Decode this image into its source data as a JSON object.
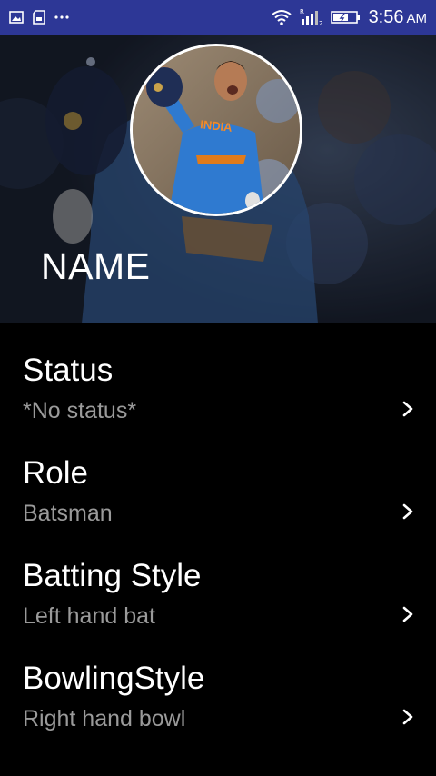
{
  "status_bar": {
    "time": "3:56",
    "ampm": "AM",
    "background": "#2d3796",
    "left_icons": [
      "image-icon",
      "sd-card-icon",
      "more-dots-icon"
    ],
    "right_icons": [
      "wifi-icon",
      "signal-icon",
      "battery-icon"
    ]
  },
  "profile": {
    "name": "NAME"
  },
  "list": [
    {
      "title": "Status",
      "value": "*No status*"
    },
    {
      "title": "Role",
      "value": "Batsman"
    },
    {
      "title": "Batting Style",
      "value": "Left hand bat"
    },
    {
      "title": "BowlingStyle",
      "value": "Right hand bowl"
    }
  ],
  "colors": {
    "background": "#000000",
    "primary_text": "#ffffff",
    "secondary_text": "#9a9a9a"
  }
}
